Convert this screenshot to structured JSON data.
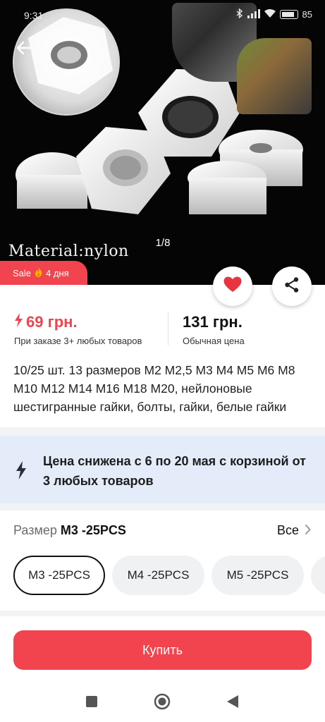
{
  "status_bar": {
    "time": "9:31",
    "battery_percent": "85",
    "battery_level": 0.85
  },
  "gallery": {
    "image_caption": "Material:nylon",
    "counter": "1/8"
  },
  "sale_badge": {
    "label": "Sale",
    "icon": "fire-icon",
    "duration": "4 дня"
  },
  "actions": {
    "favorite_icon": "heart-icon",
    "share_icon": "share-icon"
  },
  "pricing": {
    "sale_price": "69 грн.",
    "sale_note": "При заказе 3+ любых товаров",
    "regular_price": "131 грн.",
    "regular_note": "Обычная цена"
  },
  "product": {
    "title": "10/25 шт. 13 размеров M2 M2,5 M3 M4 M5 M6 M8 M10 M12 M14 M16 M18 M20, нейлоновые шестигранные гайки, болты, гайки, белые гайки"
  },
  "promo": {
    "text": "Цена снижена с 6 по 20 мая с корзиной от 3 любых товаров"
  },
  "size": {
    "label": "Размер",
    "selected": "M3 -25PCS",
    "all_label": "Все",
    "options": [
      "M3 -25PCS",
      "M4 -25PCS",
      "M5 -25PCS",
      ""
    ]
  },
  "buy": {
    "label": "Купить"
  },
  "colors": {
    "accent": "#f2444e",
    "promo_bg": "#e4ecf9",
    "chip_bg": "#f0f1f3"
  }
}
